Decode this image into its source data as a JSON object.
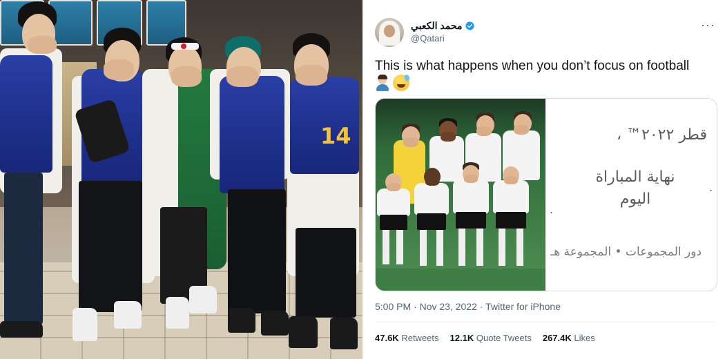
{
  "tweet": {
    "author_name": "محمد الكعبي",
    "author_handle": "@Qatari",
    "more_icon": "···",
    "text": "This is what happens when you don’t focus on football",
    "emojis": [
      "man-emoji",
      "grinning-sweat-emoji"
    ],
    "timestamp": "5:00 PM · Nov 23, 2022 · Twitter for iPhone",
    "stats": [
      {
        "count": "47.6K",
        "label": "Retweets"
      },
      {
        "count": "12.1K",
        "label": "Quote Tweets"
      },
      {
        "count": "267.4K",
        "label": "Likes"
      }
    ]
  },
  "media_card": {
    "line1": "قطر ٢٠٢٢™ ،",
    "line2a": "نهاية المباراة",
    "line2b": "اليوم",
    "line3": "دور المجموعات • المجموعة هـ"
  },
  "photo": {
    "jersey_number": "14"
  },
  "colors": {
    "verified": "#1d9bf0",
    "japan_blue": "#1e2f8a",
    "text_primary": "#0f1419",
    "text_secondary": "#536471"
  }
}
